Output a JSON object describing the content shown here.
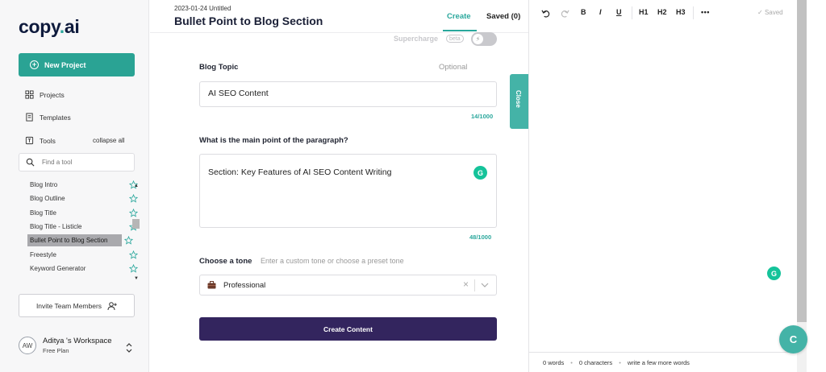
{
  "sidebar": {
    "logo_main": "copy",
    "logo_dot": ".",
    "logo_suffix": "ai",
    "new_project": "New Project",
    "nav": {
      "projects": "Projects",
      "templates": "Templates",
      "tools": "Tools"
    },
    "collapse_all": "collapse all",
    "find_tool_placeholder": "Find a tool",
    "tools": [
      {
        "label": "Blog Intro"
      },
      {
        "label": "Blog Outline"
      },
      {
        "label": "Blog Title"
      },
      {
        "label": "Blog Title - Listicle"
      },
      {
        "label": "Bullet Point to Blog Section"
      },
      {
        "label": "Freestyle"
      },
      {
        "label": "Keyword Generator"
      }
    ],
    "invite": "Invite Team Members",
    "workspace": {
      "initials": "AW",
      "name": "Aditya 's Workspace",
      "plan": "Free Plan"
    }
  },
  "document": {
    "date": "2023-01-24 Untitled",
    "title": "Bullet Point to Blog Section"
  },
  "tabs": {
    "create": "Create",
    "saved": "Saved (0)"
  },
  "supercharge": {
    "label": "Supercharge",
    "badge": "beta"
  },
  "form": {
    "blog_topic_label": "Blog Topic",
    "optional": "Optional",
    "blog_topic_value": "AI SEO Content",
    "blog_topic_count": "14/1000",
    "main_point_label": "What is the main point of the paragraph?",
    "main_point_value": "Section: Key Features of AI SEO Content Writing",
    "main_point_count": "48/1000",
    "tone_label": "Choose a tone",
    "tone_hint": "Enter a custom tone or choose a preset tone",
    "tone_value": "Professional",
    "create_button": "Create Content"
  },
  "close_tab": "Close",
  "editor": {
    "toolbar": {
      "bold": "B",
      "italic": "I",
      "underline": "U",
      "h1": "H1",
      "h2": "H2",
      "h3": "H3",
      "more": "•••",
      "saved": "Saved"
    },
    "status": {
      "words": "0 words",
      "characters": "0 characters",
      "hint": "write a few more words"
    }
  },
  "colors": {
    "accent": "#2aa394",
    "primary_button": "#33255e"
  }
}
